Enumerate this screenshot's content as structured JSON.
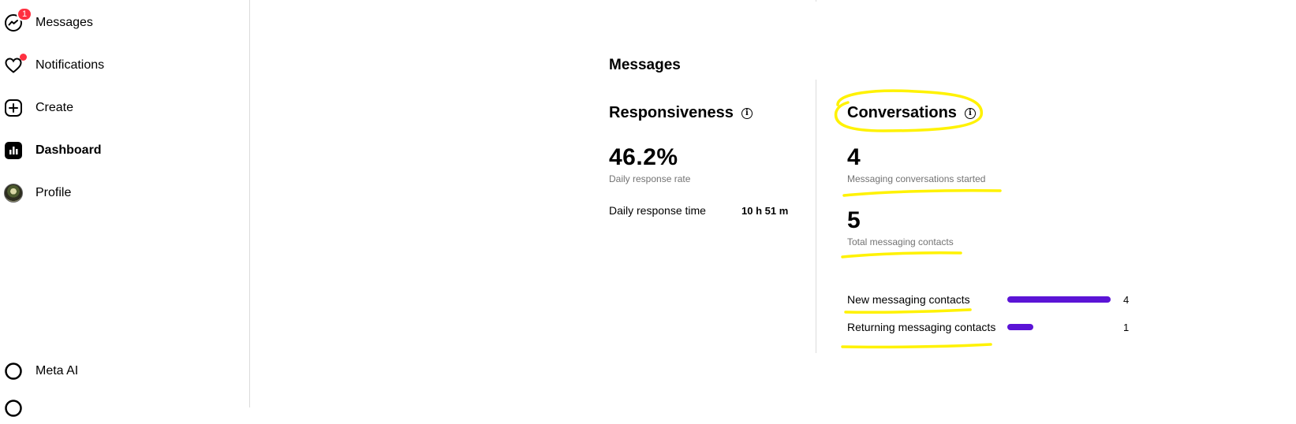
{
  "sidebar": {
    "items": [
      {
        "label": "Messages",
        "icon": "messenger-icon",
        "badge": "1"
      },
      {
        "label": "Notifications",
        "icon": "heart-icon"
      },
      {
        "label": "Create",
        "icon": "plus-square-icon"
      },
      {
        "label": "Dashboard",
        "icon": "dashboard-icon"
      },
      {
        "label": "Profile",
        "icon": "avatar"
      },
      {
        "label": "Meta AI",
        "icon": "meta-ai-icon"
      }
    ]
  },
  "main": {
    "section_title": "Messages",
    "responsiveness": {
      "title": "Responsiveness",
      "rate_value": "46.2%",
      "rate_caption": "Daily response rate",
      "time_label": "Daily response time",
      "time_value": "10 h 51 m"
    },
    "conversations": {
      "title": "Conversations",
      "started_value": "4",
      "started_caption": "Messaging conversations started",
      "contacts_value": "5",
      "contacts_caption": "Total messaging contacts",
      "breakdown": [
        {
          "label": "New messaging contacts",
          "value": "4",
          "fraction": 1.0
        },
        {
          "label": "Returning messaging contacts",
          "value": "1",
          "fraction": 0.25
        }
      ]
    }
  },
  "colors": {
    "bar": "#5b14d6",
    "badge": "#ff3040",
    "highlight": "#fff200"
  }
}
